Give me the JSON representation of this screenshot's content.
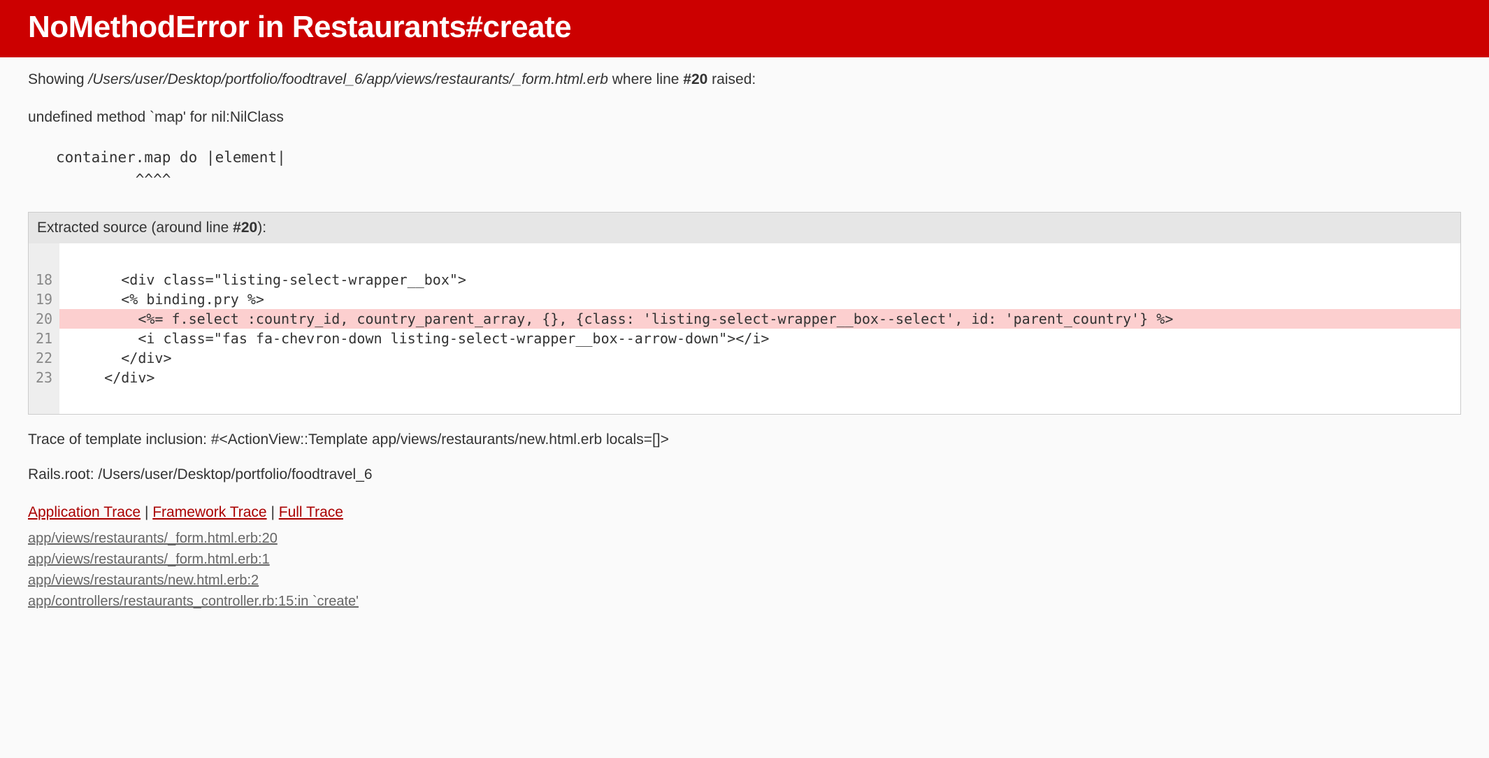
{
  "header": {
    "title": "NoMethodError in Restaurants#create"
  },
  "showing": {
    "prefix": "Showing ",
    "path": "/Users/user/Desktop/portfolio/foodtravel_6/app/views/restaurants/_form.html.erb",
    "mid": " where line ",
    "line": "#20",
    "suffix": " raised:"
  },
  "error_message": "undefined method `map' for nil:NilClass",
  "error_context": "container.map do |element|\n         ^^^^",
  "extracted": {
    "label_prefix": "Extracted source (around line ",
    "line": "#20",
    "label_suffix": "):",
    "lines": [
      {
        "num": "18",
        "src": "    <div class=\"listing-select-wrapper__box\">",
        "hl": false
      },
      {
        "num": "19",
        "src": "    <% binding.pry %>",
        "hl": false
      },
      {
        "num": "20",
        "src": "      <%= f.select :country_id, country_parent_array, {}, {class: 'listing-select-wrapper__box--select', id: 'parent_country'} %>",
        "hl": true
      },
      {
        "num": "21",
        "src": "      <i class=\"fas fa-chevron-down listing-select-wrapper__box--arrow-down\"></i>",
        "hl": false
      },
      {
        "num": "22",
        "src": "    </div>",
        "hl": false
      },
      {
        "num": "23",
        "src": "  </div>",
        "hl": false
      }
    ]
  },
  "trace_inclusion": "Trace of template inclusion: #<ActionView::Template app/views/restaurants/new.html.erb locals=[]>",
  "rails_root": "Rails.root: /Users/user/Desktop/portfolio/foodtravel_6",
  "trace_tabs": {
    "application": "Application Trace",
    "framework": "Framework Trace",
    "full": "Full Trace"
  },
  "trace_lines": [
    "app/views/restaurants/_form.html.erb:20",
    "app/views/restaurants/_form.html.erb:1",
    "app/views/restaurants/new.html.erb:2",
    "app/controllers/restaurants_controller.rb:15:in `create'"
  ]
}
